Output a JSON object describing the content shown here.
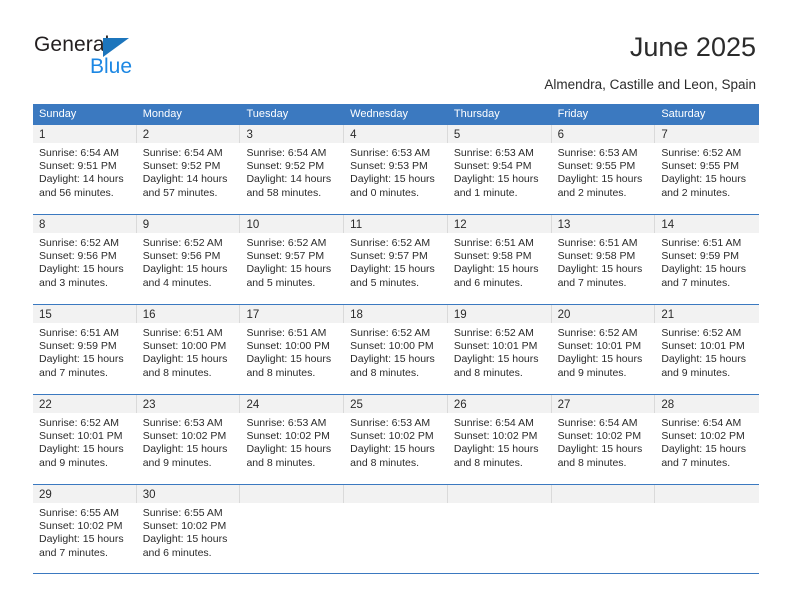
{
  "brand": {
    "name_top": "General",
    "name_bottom": "Blue",
    "accent_color": "#1c75bc",
    "blue_text_color": "#1c87e3"
  },
  "header": {
    "title": "June 2025",
    "subtitle": "Almendra, Castille and Leon, Spain"
  },
  "calendar": {
    "header_bg": "#3b79c0",
    "daynum_bg": "#f2f2f2",
    "weekday_headers": [
      "Sunday",
      "Monday",
      "Tuesday",
      "Wednesday",
      "Thursday",
      "Friday",
      "Saturday"
    ],
    "weeks": [
      [
        {
          "day": "1",
          "sunrise": "Sunrise: 6:54 AM",
          "sunset": "Sunset: 9:51 PM",
          "daylight1": "Daylight: 14 hours",
          "daylight2": "and 56 minutes."
        },
        {
          "day": "2",
          "sunrise": "Sunrise: 6:54 AM",
          "sunset": "Sunset: 9:52 PM",
          "daylight1": "Daylight: 14 hours",
          "daylight2": "and 57 minutes."
        },
        {
          "day": "3",
          "sunrise": "Sunrise: 6:54 AM",
          "sunset": "Sunset: 9:52 PM",
          "daylight1": "Daylight: 14 hours",
          "daylight2": "and 58 minutes."
        },
        {
          "day": "4",
          "sunrise": "Sunrise: 6:53 AM",
          "sunset": "Sunset: 9:53 PM",
          "daylight1": "Daylight: 15 hours",
          "daylight2": "and 0 minutes."
        },
        {
          "day": "5",
          "sunrise": "Sunrise: 6:53 AM",
          "sunset": "Sunset: 9:54 PM",
          "daylight1": "Daylight: 15 hours",
          "daylight2": "and 1 minute."
        },
        {
          "day": "6",
          "sunrise": "Sunrise: 6:53 AM",
          "sunset": "Sunset: 9:55 PM",
          "daylight1": "Daylight: 15 hours",
          "daylight2": "and 2 minutes."
        },
        {
          "day": "7",
          "sunrise": "Sunrise: 6:52 AM",
          "sunset": "Sunset: 9:55 PM",
          "daylight1": "Daylight: 15 hours",
          "daylight2": "and 2 minutes."
        }
      ],
      [
        {
          "day": "8",
          "sunrise": "Sunrise: 6:52 AM",
          "sunset": "Sunset: 9:56 PM",
          "daylight1": "Daylight: 15 hours",
          "daylight2": "and 3 minutes."
        },
        {
          "day": "9",
          "sunrise": "Sunrise: 6:52 AM",
          "sunset": "Sunset: 9:56 PM",
          "daylight1": "Daylight: 15 hours",
          "daylight2": "and 4 minutes."
        },
        {
          "day": "10",
          "sunrise": "Sunrise: 6:52 AM",
          "sunset": "Sunset: 9:57 PM",
          "daylight1": "Daylight: 15 hours",
          "daylight2": "and 5 minutes."
        },
        {
          "day": "11",
          "sunrise": "Sunrise: 6:52 AM",
          "sunset": "Sunset: 9:57 PM",
          "daylight1": "Daylight: 15 hours",
          "daylight2": "and 5 minutes."
        },
        {
          "day": "12",
          "sunrise": "Sunrise: 6:51 AM",
          "sunset": "Sunset: 9:58 PM",
          "daylight1": "Daylight: 15 hours",
          "daylight2": "and 6 minutes."
        },
        {
          "day": "13",
          "sunrise": "Sunrise: 6:51 AM",
          "sunset": "Sunset: 9:58 PM",
          "daylight1": "Daylight: 15 hours",
          "daylight2": "and 7 minutes."
        },
        {
          "day": "14",
          "sunrise": "Sunrise: 6:51 AM",
          "sunset": "Sunset: 9:59 PM",
          "daylight1": "Daylight: 15 hours",
          "daylight2": "and 7 minutes."
        }
      ],
      [
        {
          "day": "15",
          "sunrise": "Sunrise: 6:51 AM",
          "sunset": "Sunset: 9:59 PM",
          "daylight1": "Daylight: 15 hours",
          "daylight2": "and 7 minutes."
        },
        {
          "day": "16",
          "sunrise": "Sunrise: 6:51 AM",
          "sunset": "Sunset: 10:00 PM",
          "daylight1": "Daylight: 15 hours",
          "daylight2": "and 8 minutes."
        },
        {
          "day": "17",
          "sunrise": "Sunrise: 6:51 AM",
          "sunset": "Sunset: 10:00 PM",
          "daylight1": "Daylight: 15 hours",
          "daylight2": "and 8 minutes."
        },
        {
          "day": "18",
          "sunrise": "Sunrise: 6:52 AM",
          "sunset": "Sunset: 10:00 PM",
          "daylight1": "Daylight: 15 hours",
          "daylight2": "and 8 minutes."
        },
        {
          "day": "19",
          "sunrise": "Sunrise: 6:52 AM",
          "sunset": "Sunset: 10:01 PM",
          "daylight1": "Daylight: 15 hours",
          "daylight2": "and 8 minutes."
        },
        {
          "day": "20",
          "sunrise": "Sunrise: 6:52 AM",
          "sunset": "Sunset: 10:01 PM",
          "daylight1": "Daylight: 15 hours",
          "daylight2": "and 9 minutes."
        },
        {
          "day": "21",
          "sunrise": "Sunrise: 6:52 AM",
          "sunset": "Sunset: 10:01 PM",
          "daylight1": "Daylight: 15 hours",
          "daylight2": "and 9 minutes."
        }
      ],
      [
        {
          "day": "22",
          "sunrise": "Sunrise: 6:52 AM",
          "sunset": "Sunset: 10:01 PM",
          "daylight1": "Daylight: 15 hours",
          "daylight2": "and 9 minutes."
        },
        {
          "day": "23",
          "sunrise": "Sunrise: 6:53 AM",
          "sunset": "Sunset: 10:02 PM",
          "daylight1": "Daylight: 15 hours",
          "daylight2": "and 9 minutes."
        },
        {
          "day": "24",
          "sunrise": "Sunrise: 6:53 AM",
          "sunset": "Sunset: 10:02 PM",
          "daylight1": "Daylight: 15 hours",
          "daylight2": "and 8 minutes."
        },
        {
          "day": "25",
          "sunrise": "Sunrise: 6:53 AM",
          "sunset": "Sunset: 10:02 PM",
          "daylight1": "Daylight: 15 hours",
          "daylight2": "and 8 minutes."
        },
        {
          "day": "26",
          "sunrise": "Sunrise: 6:54 AM",
          "sunset": "Sunset: 10:02 PM",
          "daylight1": "Daylight: 15 hours",
          "daylight2": "and 8 minutes."
        },
        {
          "day": "27",
          "sunrise": "Sunrise: 6:54 AM",
          "sunset": "Sunset: 10:02 PM",
          "daylight1": "Daylight: 15 hours",
          "daylight2": "and 8 minutes."
        },
        {
          "day": "28",
          "sunrise": "Sunrise: 6:54 AM",
          "sunset": "Sunset: 10:02 PM",
          "daylight1": "Daylight: 15 hours",
          "daylight2": "and 7 minutes."
        }
      ],
      [
        {
          "day": "29",
          "sunrise": "Sunrise: 6:55 AM",
          "sunset": "Sunset: 10:02 PM",
          "daylight1": "Daylight: 15 hours",
          "daylight2": "and 7 minutes."
        },
        {
          "day": "30",
          "sunrise": "Sunrise: 6:55 AM",
          "sunset": "Sunset: 10:02 PM",
          "daylight1": "Daylight: 15 hours",
          "daylight2": "and 6 minutes."
        },
        {
          "day": "",
          "sunrise": "",
          "sunset": "",
          "daylight1": "",
          "daylight2": ""
        },
        {
          "day": "",
          "sunrise": "",
          "sunset": "",
          "daylight1": "",
          "daylight2": ""
        },
        {
          "day": "",
          "sunrise": "",
          "sunset": "",
          "daylight1": "",
          "daylight2": ""
        },
        {
          "day": "",
          "sunrise": "",
          "sunset": "",
          "daylight1": "",
          "daylight2": ""
        },
        {
          "day": "",
          "sunrise": "",
          "sunset": "",
          "daylight1": "",
          "daylight2": ""
        }
      ]
    ]
  }
}
